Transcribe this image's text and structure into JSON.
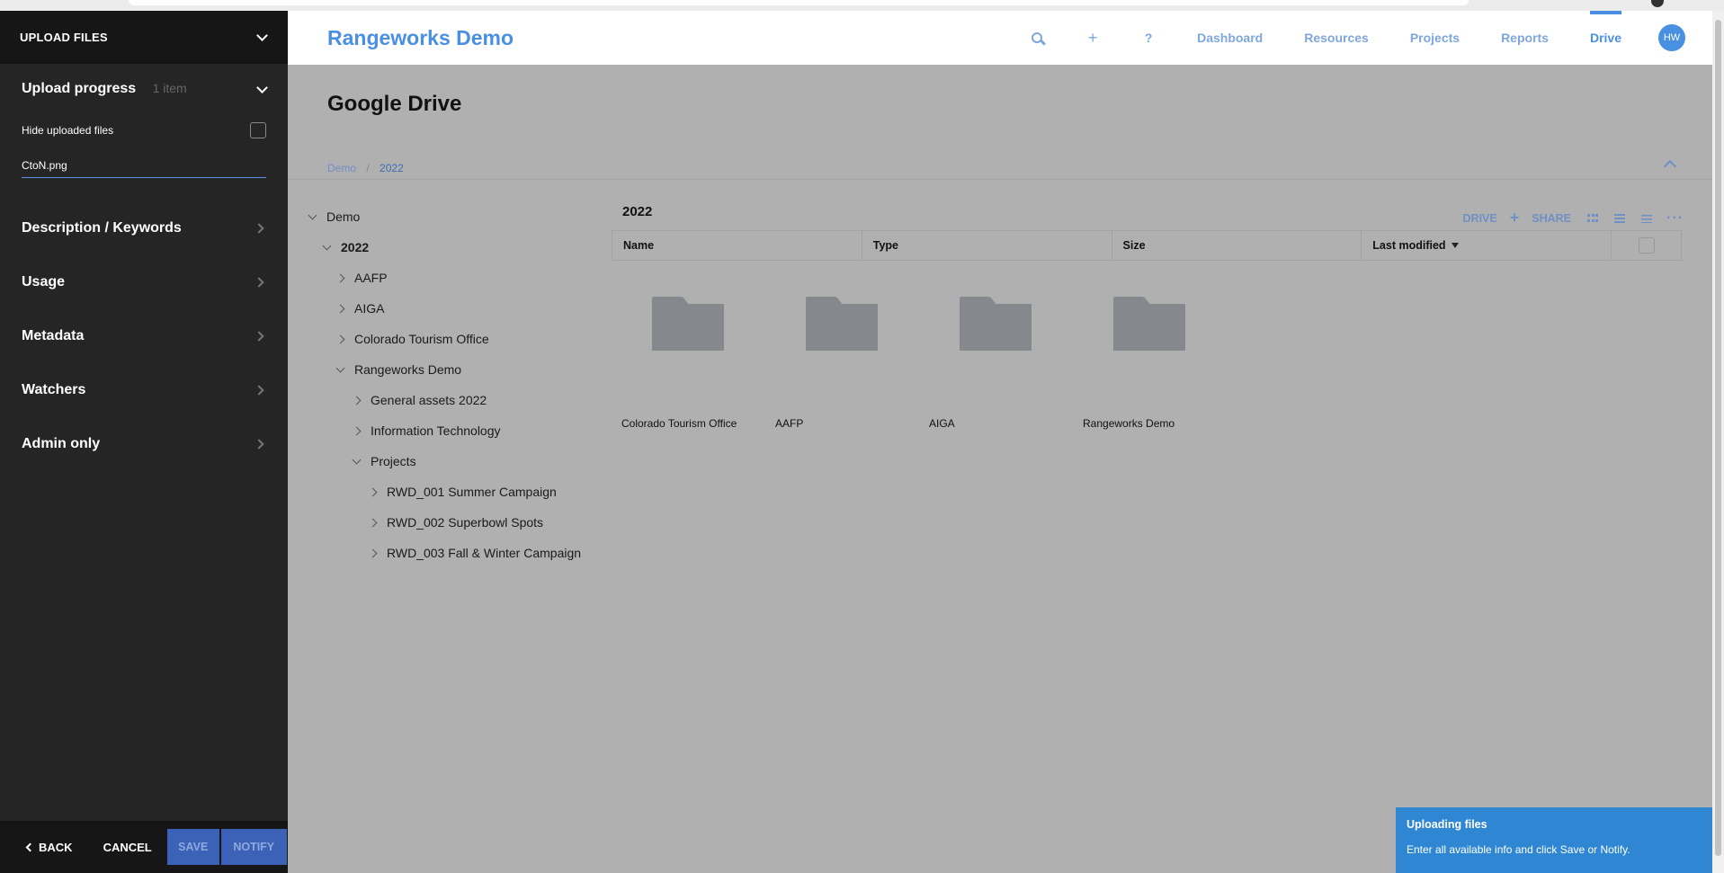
{
  "upload_panel": {
    "header_title": "UPLOAD FILES",
    "progress_label": "Upload progress",
    "progress_count": "1 item",
    "hide_uploaded_label": "Hide uploaded files",
    "file_name": "CtoN.png",
    "sections": [
      "Description / Keywords",
      "Usage",
      "Metadata",
      "Watchers",
      "Admin only"
    ],
    "footer": {
      "back": "BACK",
      "cancel": "CANCEL",
      "save": "SAVE",
      "notify": "NOTIFY"
    }
  },
  "header": {
    "brand": "Rangeworks Demo",
    "add_icon": "+",
    "help_icon": "?",
    "nav": [
      "Dashboard",
      "Resources",
      "Projects",
      "Reports",
      "Drive"
    ],
    "active_nav": "Drive",
    "avatar_initials": "HW"
  },
  "page": {
    "title": "Google Drive",
    "breadcrumb": [
      "Demo",
      "2022"
    ],
    "breadcrumb_sep": "/"
  },
  "tree": {
    "items": [
      {
        "label": "Demo",
        "state": "open"
      },
      {
        "label": "2022",
        "state": "open"
      },
      {
        "label": "AAFP",
        "state": "closed"
      },
      {
        "label": "AIGA",
        "state": "closed"
      },
      {
        "label": "Colorado Tourism Office",
        "state": "closed"
      },
      {
        "label": "Rangeworks Demo",
        "state": "open"
      },
      {
        "label": "General assets 2022",
        "state": "closed"
      },
      {
        "label": "Information Technology",
        "state": "closed"
      },
      {
        "label": "Projects",
        "state": "open"
      },
      {
        "label": "RWD_001 Summer Campaign",
        "state": "closed"
      },
      {
        "label": "RWD_002 Superbowl Spots",
        "state": "closed"
      },
      {
        "label": "RWD_003 Fall & Winter Campaign",
        "state": "closed"
      }
    ]
  },
  "content": {
    "folder_title": "2022",
    "toolbar": {
      "drive": "DRIVE",
      "plus": "+",
      "share": "SHARE",
      "more": "···"
    },
    "columns": [
      "Name",
      "Type",
      "Size",
      "Last modified"
    ],
    "folders": [
      "Colorado Tourism Office",
      "AAFP",
      "AIGA",
      "Rangeworks Demo"
    ]
  },
  "toast": {
    "title": "Uploading files",
    "message": "Enter all available info and click Save or Notify."
  },
  "colors": {
    "brand_blue": "#4a90e2",
    "side_panel": "#252525",
    "overlay_gray": "#b0b0b0",
    "toast_blue": "#2f87d4",
    "button_blue": "#3c62b8"
  }
}
